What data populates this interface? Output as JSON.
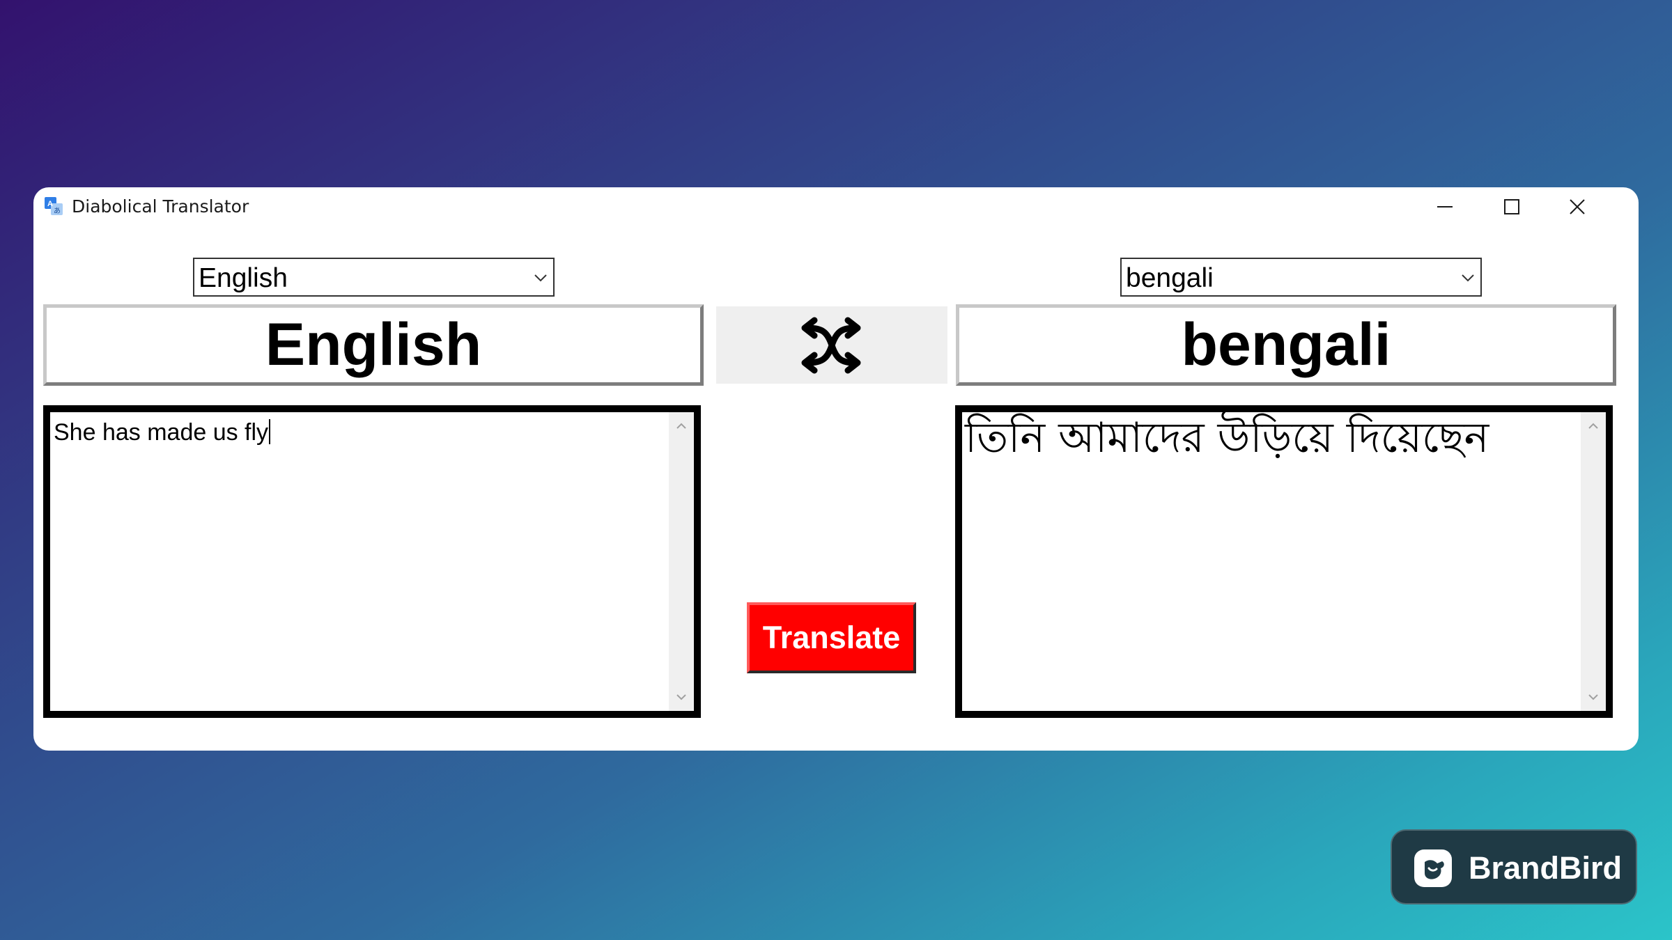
{
  "window": {
    "title": "Diabolical Translator"
  },
  "source": {
    "selected_language": "English",
    "label": "English",
    "text": "She has made us fly"
  },
  "target": {
    "selected_language": "bengali",
    "label": "bengali",
    "text": "তিনি আমাদের উড়িয়ে দিয়েছেন"
  },
  "actions": {
    "translate_label": "Translate",
    "swap_icon": "shuffle-icon"
  },
  "branding": {
    "name": "BrandBird"
  },
  "colors": {
    "translate_button": "#ff0000",
    "badge_background": "#1f3a45",
    "window": "#ffffff"
  }
}
